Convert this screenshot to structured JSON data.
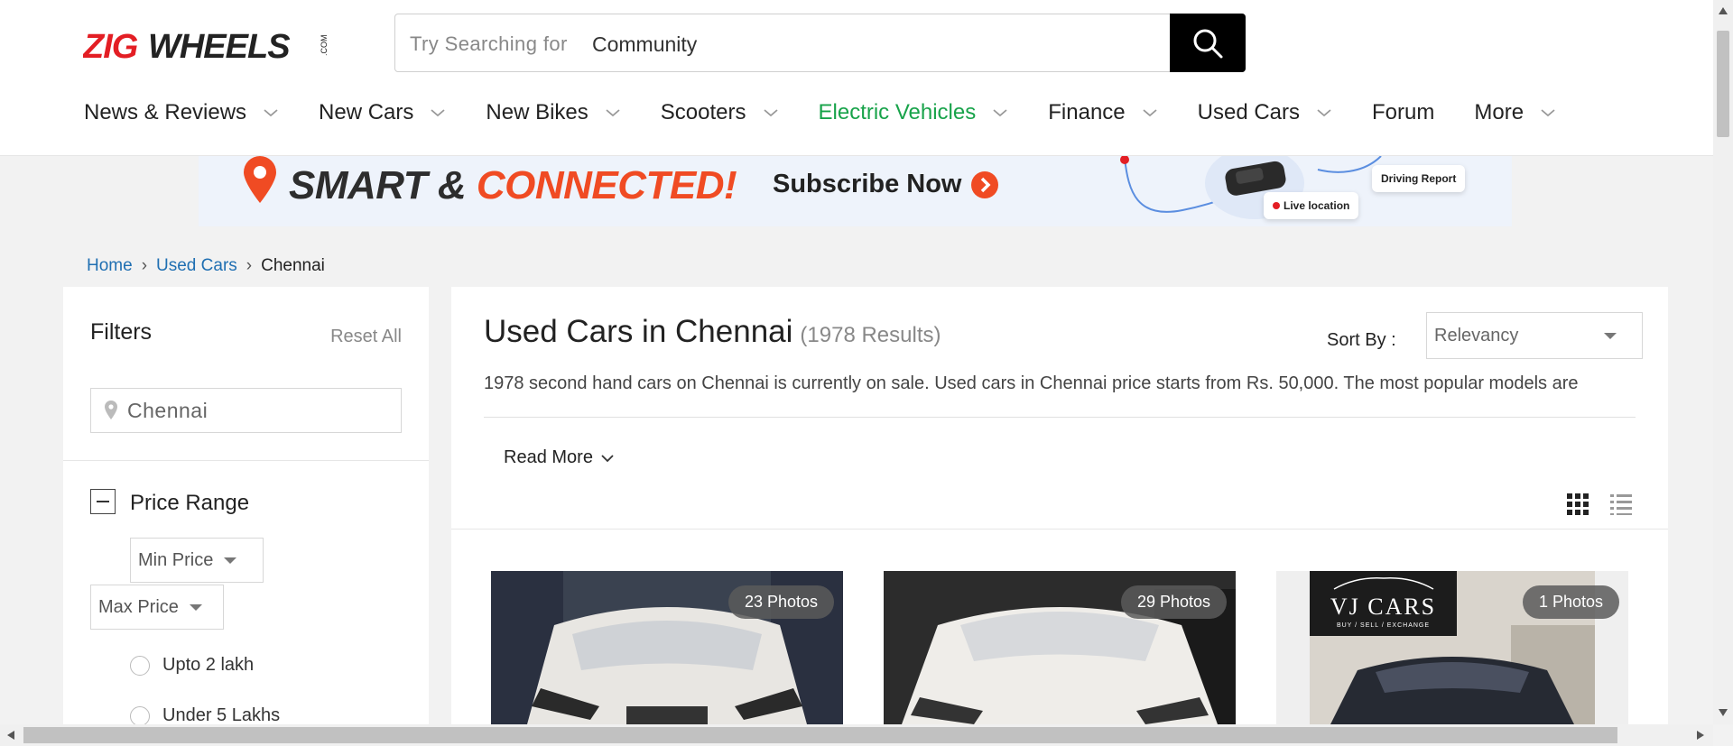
{
  "header": {
    "logo_text": "ZIGWHEELS",
    "logo_suffix": ".COM",
    "search": {
      "placeholder": "Try Searching for",
      "value": "Community"
    },
    "nav": [
      {
        "label": "News & Reviews",
        "dropdown": true
      },
      {
        "label": "New Cars",
        "dropdown": true
      },
      {
        "label": "New Bikes",
        "dropdown": true
      },
      {
        "label": "Scooters",
        "dropdown": true
      },
      {
        "label": "Electric Vehicles",
        "dropdown": true,
        "highlight": "#18a34a"
      },
      {
        "label": "Finance",
        "dropdown": true
      },
      {
        "label": "Used Cars",
        "dropdown": true
      },
      {
        "label": "Forum",
        "dropdown": false
      },
      {
        "label": "More",
        "dropdown": true
      }
    ]
  },
  "banner": {
    "headline_a": "SMART & ",
    "headline_b": "CONNECTED!",
    "cta": "Subscribe Now",
    "card1": "Driving Report",
    "card2": "Live location"
  },
  "breadcrumb": {
    "home": "Home",
    "used_cars": "Used Cars",
    "current": "Chennai"
  },
  "filters": {
    "title": "Filters",
    "reset": "Reset All",
    "location": "Chennai",
    "price_range": {
      "title": "Price Range",
      "min": "Min Price",
      "max": "Max Price",
      "options": [
        "Upto 2 lakh",
        "Under 5 Lakhs"
      ]
    }
  },
  "main": {
    "title": "Used Cars in Chennai",
    "count": "(1978 Results)",
    "sort_label": "Sort By :",
    "sort_value": "Relevancy",
    "description": "1978 second hand cars on Chennai is currently on sale. Used cars in Chennai price starts from Rs. 50,000. The most popular models are",
    "read_more": "Read More",
    "cards": [
      {
        "photos": "23 Photos"
      },
      {
        "photos": "29 Photos"
      },
      {
        "photos": "1 Photos",
        "dealer": "VJ CARS",
        "dealer_tag": "BUY / SELL / EXCHANGE"
      }
    ]
  },
  "colors": {
    "brand_red": "#e31e24",
    "accent_green": "#18a34a",
    "link_blue": "#1f6fb2",
    "banner_orange": "#f04b23"
  }
}
